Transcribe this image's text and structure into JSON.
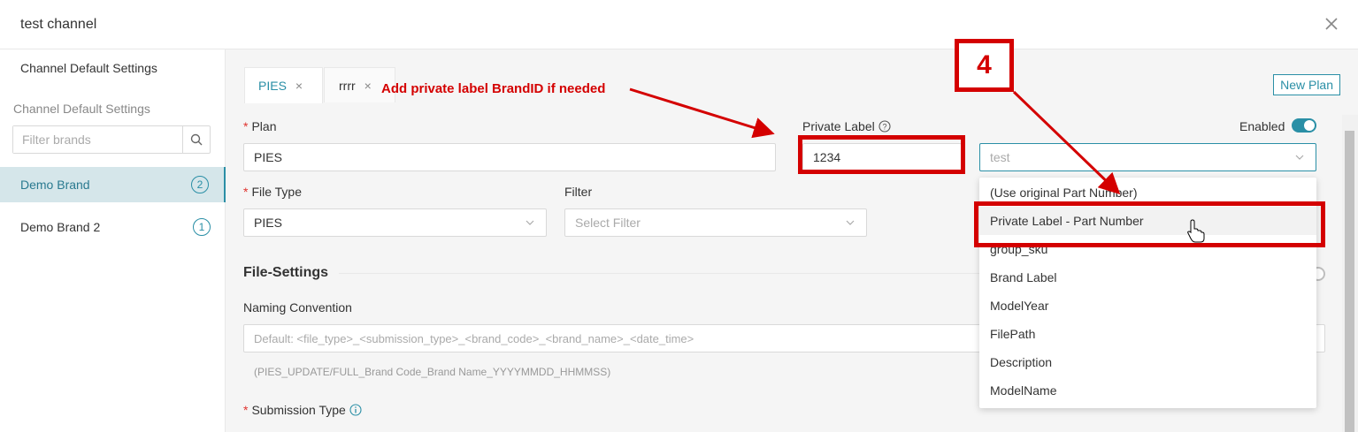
{
  "window": {
    "title": "test channel"
  },
  "sidebar": {
    "heading": "Channel Default Settings",
    "subheading": "Channel Default Settings",
    "filter_placeholder": "Filter brands",
    "brands": [
      {
        "label": "Demo Brand",
        "count": "2",
        "active": true
      },
      {
        "label": "Demo Brand 2",
        "count": "1",
        "active": false
      }
    ]
  },
  "tabs": [
    {
      "label": "PIES",
      "close": "×"
    },
    {
      "label": "rrrr",
      "close": "×"
    }
  ],
  "new_plan_label": "New Plan",
  "form": {
    "plan_label": "Plan",
    "plan_value": "PIES",
    "private_label_label": "Private Label",
    "private_label_value": "1234",
    "enabled_label": "Enabled",
    "part_number_select_value": "test",
    "file_type_label": "File Type",
    "file_type_value": "PIES",
    "filter_label": "Filter",
    "filter_placeholder": "Select Filter"
  },
  "file_settings": {
    "title": "File-Settings",
    "naming_label": "Naming Convention",
    "naming_placeholder": "Default: <file_type>_<submission_type>_<brand_code>_<brand_name>_<date_time>",
    "naming_hint": "(PIES_UPDATE/FULL_Brand Code_Brand Name_YYYYMMDD_HHMMSS)",
    "submission_type_label": "Submission Type"
  },
  "dropdown_options": [
    "(Use original Part Number)",
    "Private Label - Part Number",
    "group_sku",
    "Brand Label",
    "ModelYear",
    "FilePath",
    "Description",
    "ModelName"
  ],
  "annotations": {
    "callout_text": "Add private label BrandID if needed",
    "step_number": "4"
  },
  "colors": {
    "accent": "#2a8fa6",
    "annotation": "#d40000",
    "required": "#e0332e"
  }
}
